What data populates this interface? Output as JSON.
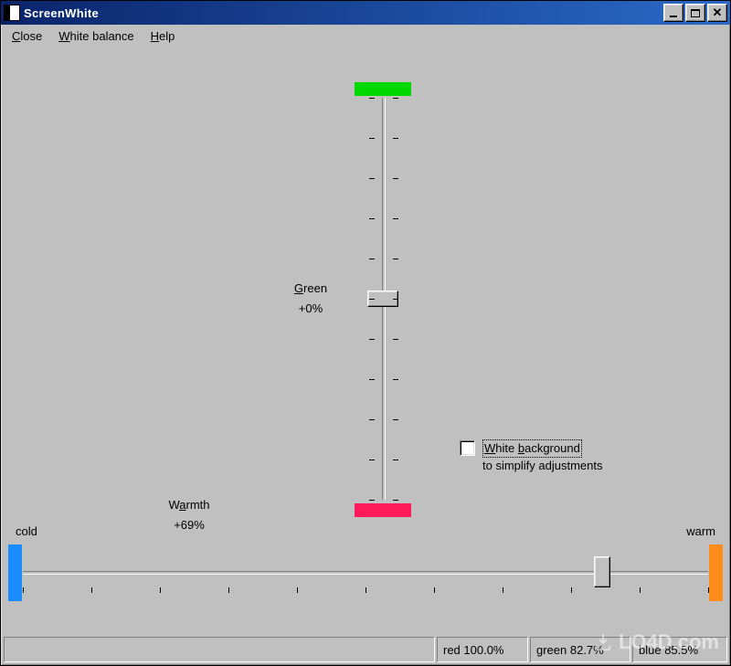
{
  "title": "ScreenWhite",
  "menu": {
    "close": "Close",
    "white_balance": "White balance",
    "help": "Help"
  },
  "green_slider": {
    "label": "Green",
    "value_text": "+0%",
    "value_percent": 0,
    "top_color": "#00d800",
    "bottom_color": "#ff1a5a"
  },
  "warmth_slider": {
    "label": "Warmth",
    "value_text": "+69%",
    "value_percent": 69,
    "cold_label": "cold",
    "warm_label": "warm",
    "cold_color": "#1a8cff",
    "warm_color": "#ff8c1a"
  },
  "checkbox": {
    "checked": false,
    "line1": "White background",
    "line2": "to simplify adjustments"
  },
  "status": {
    "red": "red 100.0%",
    "green": "green 82.7%",
    "blue": "blue 85.5%"
  },
  "watermark": "LO4D.com"
}
